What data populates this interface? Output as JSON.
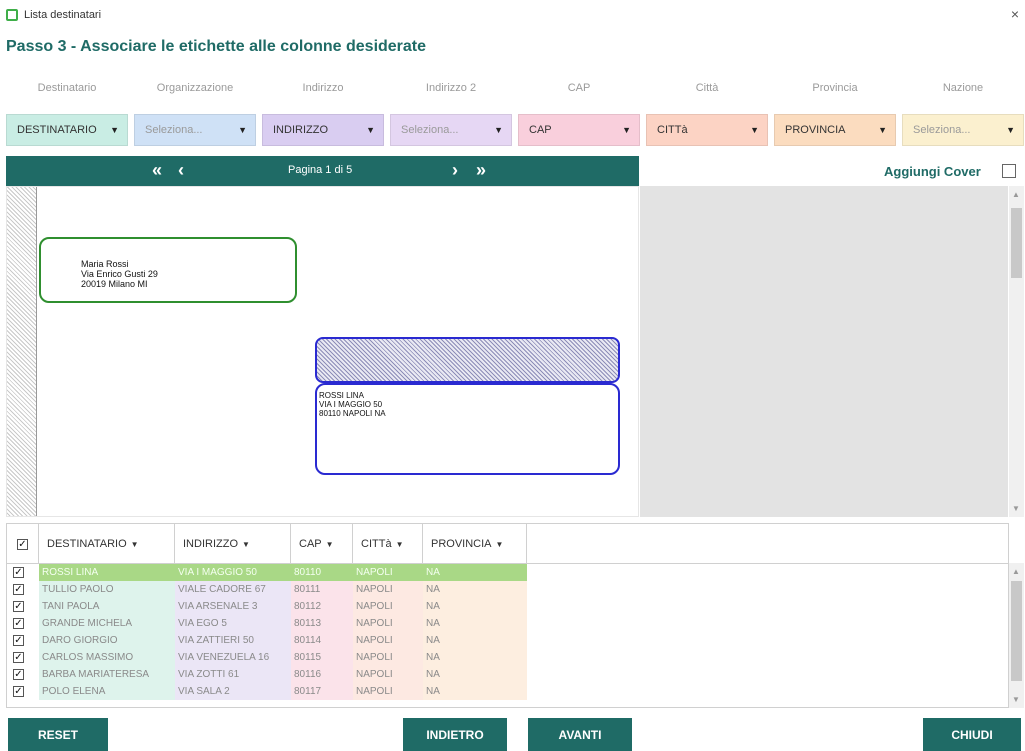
{
  "window": {
    "title": "Lista destinatari",
    "close_glyph": "×"
  },
  "step_title": "Passo 3 - Associare le etichette alle colonne desiderate",
  "columns": [
    {
      "label": "Destinatario",
      "select": "DESTINATARIO",
      "placeholder": false,
      "color": "#c9ede4"
    },
    {
      "label": "Organizzazione",
      "select": "Seleziona...",
      "placeholder": true,
      "color": "#cfe1f6"
    },
    {
      "label": "Indirizzo",
      "select": "INDIRIZZO",
      "placeholder": false,
      "color": "#d9cdf1"
    },
    {
      "label": "Indirizzo 2",
      "select": "Seleziona...",
      "placeholder": true,
      "color": "#e6d7f4"
    },
    {
      "label": "CAP",
      "select": "CAP",
      "placeholder": false,
      "color": "#f9cfdc"
    },
    {
      "label": "Città",
      "select": "CITTà",
      "placeholder": false,
      "color": "#fcd3c4"
    },
    {
      "label": "Provincia",
      "select": "PROVINCIA",
      "placeholder": false,
      "color": "#fbdcbf"
    },
    {
      "label": "Nazione",
      "select": "Seleziona...",
      "placeholder": true,
      "color": "#fbf0cf"
    }
  ],
  "pager": {
    "first": "«",
    "prev": "‹",
    "label": "Pagina 1 di 5",
    "next": "›",
    "last": "»"
  },
  "cover": {
    "label": "Aggiungi Cover",
    "checked": false
  },
  "preview": {
    "label1": [
      "Maria Rossi",
      "Via Enrico Gusti 29",
      "20019 Milano MI"
    ],
    "label2": [
      "ROSSI LINA",
      "VIA I MAGGIO 50",
      "80110 NAPOLI NA"
    ]
  },
  "grid": {
    "headers": [
      "DESTINATARIO",
      "INDIRIZZO",
      "CAP",
      "CITTà",
      "PROVINCIA"
    ],
    "rows": [
      {
        "dest": "ROSSI LINA",
        "ind": "VIA I MAGGIO 50",
        "cap": "80110",
        "cit": "NAPOLI",
        "prv": "NA",
        "selected": true
      },
      {
        "dest": "TULLIO PAOLO",
        "ind": "VIALE CADORE 67",
        "cap": "80111",
        "cit": "NAPOLI",
        "prv": "NA",
        "selected": false
      },
      {
        "dest": "TANI PAOLA",
        "ind": "VIA ARSENALE 3",
        "cap": "80112",
        "cit": "NAPOLI",
        "prv": "NA",
        "selected": false
      },
      {
        "dest": "GRANDE MICHELA",
        "ind": "VIA EGO 5",
        "cap": "80113",
        "cit": "NAPOLI",
        "prv": "NA",
        "selected": false
      },
      {
        "dest": "DARO GIORGIO",
        "ind": "VIA ZATTIERI 50",
        "cap": "80114",
        "cit": "NAPOLI",
        "prv": "NA",
        "selected": false
      },
      {
        "dest": "CARLOS MASSIMO",
        "ind": "VIA VENEZUELA 16",
        "cap": "80115",
        "cit": "NAPOLI",
        "prv": "NA",
        "selected": false
      },
      {
        "dest": "BARBA MARIATERESA",
        "ind": "VIA ZOTTI 61",
        "cap": "80116",
        "cit": "NAPOLI",
        "prv": "NA",
        "selected": false
      },
      {
        "dest": "POLO ELENA",
        "ind": "VIA SALA 2",
        "cap": "80117",
        "cit": "NAPOLI",
        "prv": "NA",
        "selected": false
      }
    ]
  },
  "buttons": {
    "reset": "RESET",
    "back": "INDIETRO",
    "next": "AVANTI",
    "close": "CHIUDI"
  },
  "theme": {
    "accent": "#1f6b66",
    "selected_row": "#a9d886"
  }
}
